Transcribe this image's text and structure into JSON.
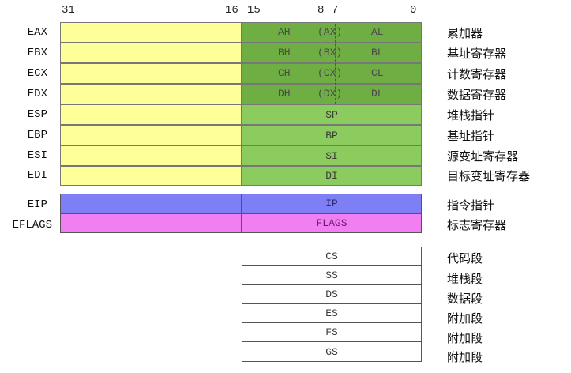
{
  "bits": {
    "b31": "31",
    "b16": "16",
    "b15": "15",
    "b8": "8",
    "b7": "7",
    "b0": "0"
  },
  "general": [
    {
      "name": "EAX",
      "hi": "AH",
      "mid": "(AX)",
      "lo": "AL",
      "desc": "累加器"
    },
    {
      "name": "EBX",
      "hi": "BH",
      "mid": "(BX)",
      "lo": "BL",
      "desc": "基址寄存器"
    },
    {
      "name": "ECX",
      "hi": "CH",
      "mid": "(CX)",
      "lo": "CL",
      "desc": "计数寄存器"
    },
    {
      "name": "EDX",
      "hi": "DH",
      "mid": "(DX)",
      "lo": "DL",
      "desc": "数据寄存器"
    }
  ],
  "index": [
    {
      "name": "ESP",
      "short": "SP",
      "desc": "堆栈指针"
    },
    {
      "name": "EBP",
      "short": "BP",
      "desc": "基址指针"
    },
    {
      "name": "ESI",
      "short": "SI",
      "desc": "源变址寄存器"
    },
    {
      "name": "EDI",
      "short": "DI",
      "desc": "目标变址寄存器"
    }
  ],
  "eip": {
    "name": "EIP",
    "short": "IP",
    "desc": "指令指针"
  },
  "eflags": {
    "name": "EFLAGS",
    "short": "FLAGS",
    "desc": "标志寄存器"
  },
  "segments": [
    {
      "name": "CS",
      "desc": "代码段"
    },
    {
      "name": "SS",
      "desc": "堆栈段"
    },
    {
      "name": "DS",
      "desc": "数据段"
    },
    {
      "name": "ES",
      "desc": "附加段"
    },
    {
      "name": "FS",
      "desc": "附加段"
    },
    {
      "name": "GS",
      "desc": "附加段"
    }
  ],
  "colors": {
    "yellow": "#ffff99",
    "green": "#8ccc5e",
    "darkgreen": "#6eae43",
    "blue": "#7f7ff5",
    "magenta": "#f27ff2"
  }
}
